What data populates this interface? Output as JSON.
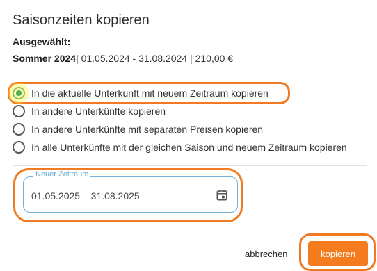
{
  "dialog": {
    "title": "Saisonzeiten kopieren",
    "selected_label": "Ausgewählt:",
    "season_name": "Sommer 2024",
    "season_details": "| 01.05.2024 - 31.08.2024 | 210,00 €"
  },
  "options": [
    {
      "label": "In die aktuelle Unterkunft mit neuem Zeitraum kopieren",
      "checked": true
    },
    {
      "label": "In andere Unterkünfte kopieren",
      "checked": false
    },
    {
      "label": "In andere Unterkünfte mit separaten Preisen kopieren",
      "checked": false
    },
    {
      "label": "In alle Unterkünfte mit der gleichen Saison und neuem Zeitraum kopieren",
      "checked": false
    }
  ],
  "date_range": {
    "legend": "Neuer Zeitraum",
    "value": "01.05.2025 – 31.08.2025",
    "icon": "calendar-icon"
  },
  "actions": {
    "cancel_label": "abbrechen",
    "submit_label": "kopieren"
  },
  "colors": {
    "accent": "#f47c1f",
    "radio_checked": "#4caf50",
    "field_border": "#6fb3d6"
  }
}
